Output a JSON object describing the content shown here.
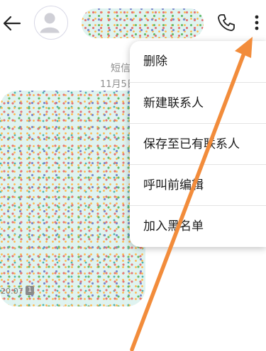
{
  "message_meta": {
    "type_label": "短信",
    "date_label": "11月5日"
  },
  "bubble": {
    "time": "20:07",
    "sim_badge": "1"
  },
  "menu": {
    "items": [
      {
        "label": "删除"
      },
      {
        "label": "新建联系人"
      },
      {
        "label": "保存至已有联系人"
      },
      {
        "label": "呼叫前编辑"
      },
      {
        "label": "加入黑名单"
      }
    ]
  },
  "icons": {
    "back": "arrow-left-icon",
    "avatar": "person-icon",
    "call": "phone-icon",
    "more": "more-vertical-icon"
  },
  "colors": {
    "annotation_arrow": "#f28c3b",
    "redaction_bg": "#dff3f0",
    "meta_text": "#8e8e8e"
  }
}
